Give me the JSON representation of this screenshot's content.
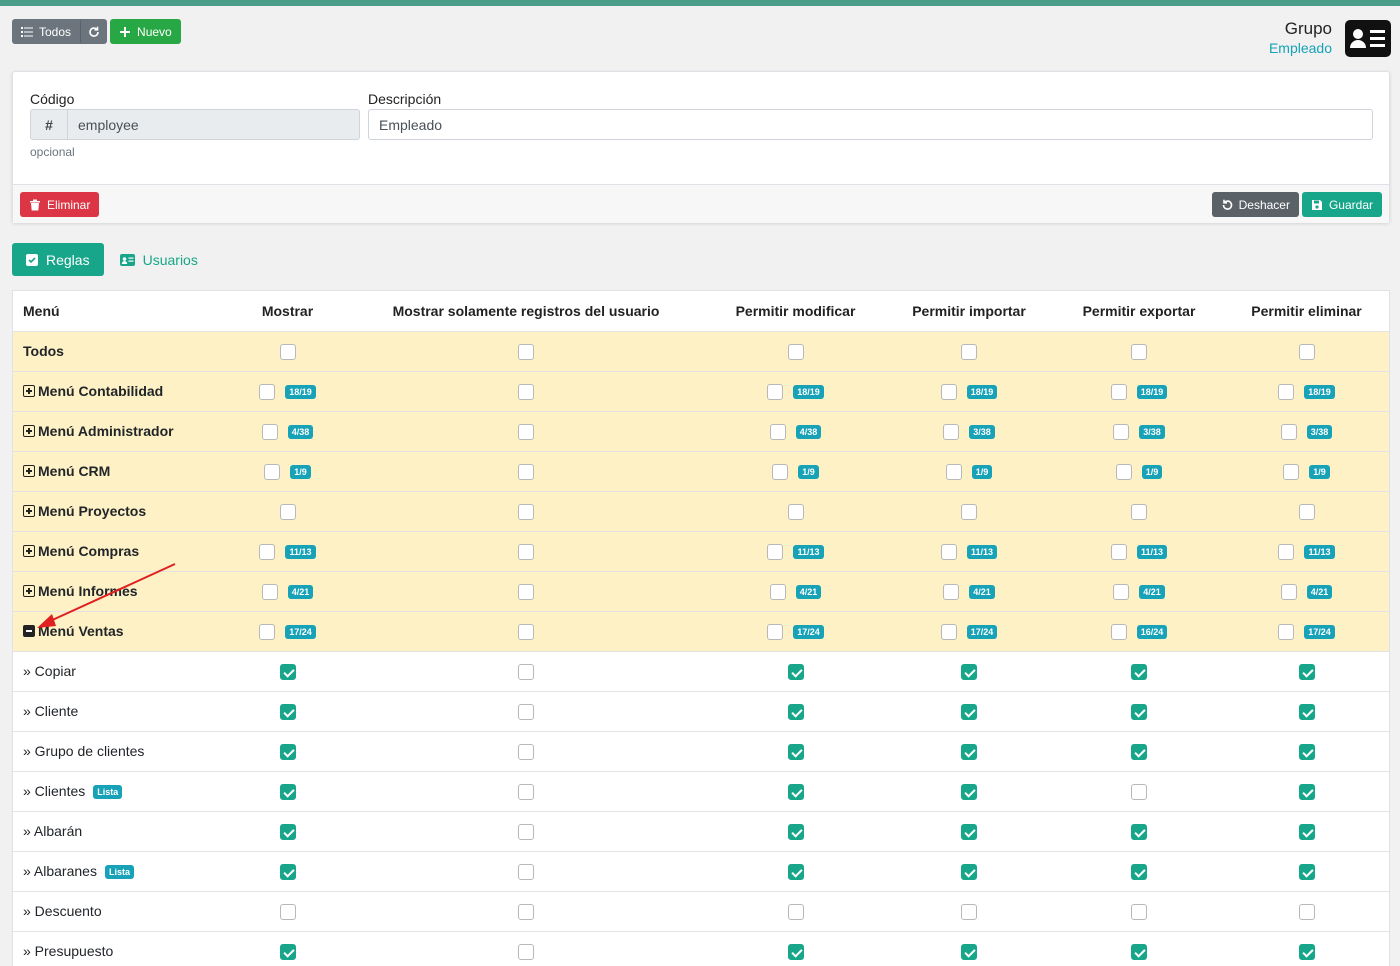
{
  "toolbar": {
    "todos_label": "Todos",
    "nuevo_label": "Nuevo"
  },
  "header": {
    "title": "Grupo",
    "subtitle": "Empleado",
    "icon": "id-card-icon"
  },
  "form": {
    "code_label": "Código",
    "code_value": "employee",
    "code_prefix": "#",
    "code_help": "opcional",
    "desc_label": "Descripción",
    "desc_value": "Empleado"
  },
  "actions": {
    "delete_label": "Eliminar",
    "undo_label": "Deshacer",
    "save_label": "Guardar"
  },
  "tabs": [
    {
      "label": "Reglas",
      "active": true,
      "icon": "check-square-icon"
    },
    {
      "label": "Usuarios",
      "active": false,
      "icon": "id-card-icon"
    }
  ],
  "table": {
    "headers": [
      "Menú",
      "Mostrar",
      "Mostrar solamente registros del usuario",
      "Permitir modificar",
      "Permitir importar",
      "Permitir exportar",
      "Permitir eliminar"
    ],
    "rows": [
      {
        "label": "Todos",
        "type": "group",
        "expand": "",
        "cells": [
          [
            false,
            ""
          ],
          [
            false,
            ""
          ],
          [
            false,
            ""
          ],
          [
            false,
            ""
          ],
          [
            false,
            ""
          ],
          [
            false,
            ""
          ]
        ]
      },
      {
        "label": "Menú Contabilidad",
        "type": "group",
        "expand": "plus",
        "cells": [
          [
            false,
            "18/19"
          ],
          [
            false,
            ""
          ],
          [
            false,
            "18/19"
          ],
          [
            false,
            "18/19"
          ],
          [
            false,
            "18/19"
          ],
          [
            false,
            "18/19"
          ]
        ]
      },
      {
        "label": "Menú Administrador",
        "type": "group",
        "expand": "plus",
        "cells": [
          [
            false,
            "4/38"
          ],
          [
            false,
            ""
          ],
          [
            false,
            "4/38"
          ],
          [
            false,
            "3/38"
          ],
          [
            false,
            "3/38"
          ],
          [
            false,
            "3/38"
          ]
        ]
      },
      {
        "label": "Menú CRM",
        "type": "group",
        "expand": "plus",
        "cells": [
          [
            false,
            "1/9"
          ],
          [
            false,
            ""
          ],
          [
            false,
            "1/9"
          ],
          [
            false,
            "1/9"
          ],
          [
            false,
            "1/9"
          ],
          [
            false,
            "1/9"
          ]
        ]
      },
      {
        "label": "Menú Proyectos",
        "type": "group",
        "expand": "plus",
        "cells": [
          [
            false,
            ""
          ],
          [
            false,
            ""
          ],
          [
            false,
            ""
          ],
          [
            false,
            ""
          ],
          [
            false,
            ""
          ],
          [
            false,
            ""
          ]
        ]
      },
      {
        "label": "Menú Compras",
        "type": "group",
        "expand": "plus",
        "cells": [
          [
            false,
            "11/13"
          ],
          [
            false,
            ""
          ],
          [
            false,
            "11/13"
          ],
          [
            false,
            "11/13"
          ],
          [
            false,
            "11/13"
          ],
          [
            false,
            "11/13"
          ]
        ]
      },
      {
        "label": "Menú Informes",
        "type": "group",
        "expand": "plus",
        "cells": [
          [
            false,
            "4/21"
          ],
          [
            false,
            ""
          ],
          [
            false,
            "4/21"
          ],
          [
            false,
            "4/21"
          ],
          [
            false,
            "4/21"
          ],
          [
            false,
            "4/21"
          ]
        ]
      },
      {
        "label": "Menú Ventas",
        "type": "group",
        "expand": "minus",
        "cells": [
          [
            false,
            "17/24"
          ],
          [
            false,
            ""
          ],
          [
            false,
            "17/24"
          ],
          [
            false,
            "17/24"
          ],
          [
            false,
            "16/24"
          ],
          [
            false,
            "17/24"
          ]
        ]
      },
      {
        "label": "» Copiar",
        "type": "item",
        "tag": "",
        "cells": [
          [
            true,
            ""
          ],
          [
            false,
            ""
          ],
          [
            true,
            ""
          ],
          [
            true,
            ""
          ],
          [
            true,
            ""
          ],
          [
            true,
            ""
          ]
        ]
      },
      {
        "label": "» Cliente",
        "type": "item",
        "tag": "",
        "cells": [
          [
            true,
            ""
          ],
          [
            false,
            ""
          ],
          [
            true,
            ""
          ],
          [
            true,
            ""
          ],
          [
            true,
            ""
          ],
          [
            true,
            ""
          ]
        ]
      },
      {
        "label": "» Grupo de clientes",
        "type": "item",
        "tag": "",
        "cells": [
          [
            true,
            ""
          ],
          [
            false,
            ""
          ],
          [
            true,
            ""
          ],
          [
            true,
            ""
          ],
          [
            true,
            ""
          ],
          [
            true,
            ""
          ]
        ]
      },
      {
        "label": "» Clientes",
        "type": "item",
        "tag": "Lista",
        "cells": [
          [
            true,
            ""
          ],
          [
            false,
            ""
          ],
          [
            true,
            ""
          ],
          [
            true,
            ""
          ],
          [
            false,
            ""
          ],
          [
            true,
            ""
          ]
        ]
      },
      {
        "label": "» Albarán",
        "type": "item",
        "tag": "",
        "cells": [
          [
            true,
            ""
          ],
          [
            false,
            ""
          ],
          [
            true,
            ""
          ],
          [
            true,
            ""
          ],
          [
            true,
            ""
          ],
          [
            true,
            ""
          ]
        ]
      },
      {
        "label": "» Albaranes",
        "type": "item",
        "tag": "Lista",
        "cells": [
          [
            true,
            ""
          ],
          [
            false,
            ""
          ],
          [
            true,
            ""
          ],
          [
            true,
            ""
          ],
          [
            true,
            ""
          ],
          [
            true,
            ""
          ]
        ]
      },
      {
        "label": "» Descuento",
        "type": "item",
        "tag": "",
        "cells": [
          [
            false,
            ""
          ],
          [
            false,
            ""
          ],
          [
            false,
            ""
          ],
          [
            false,
            ""
          ],
          [
            false,
            ""
          ],
          [
            false,
            ""
          ]
        ]
      },
      {
        "label": "» Presupuesto",
        "type": "item",
        "tag": "",
        "cells": [
          [
            true,
            ""
          ],
          [
            false,
            ""
          ],
          [
            true,
            ""
          ],
          [
            true,
            ""
          ],
          [
            true,
            ""
          ],
          [
            true,
            ""
          ]
        ]
      }
    ]
  },
  "colors": {
    "accent": "#17a689",
    "group_row": "#fdf1c5",
    "badge": "#17a2b8",
    "danger": "#dc3545",
    "annotation_arrow": "#e02020"
  }
}
